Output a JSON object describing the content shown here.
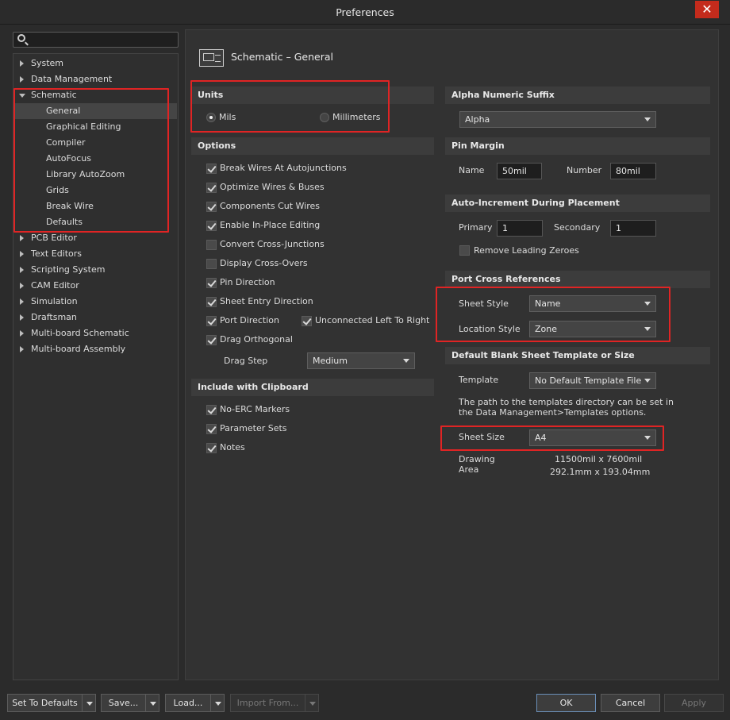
{
  "window": {
    "title": "Preferences",
    "close_glyph": "✕"
  },
  "search": {
    "placeholder": ""
  },
  "tree": [
    {
      "label": "System",
      "state": "collapsed"
    },
    {
      "label": "Data Management",
      "state": "collapsed"
    },
    {
      "label": "Schematic",
      "state": "expanded"
    },
    {
      "label": "General",
      "child": true,
      "selected": true
    },
    {
      "label": "Graphical Editing",
      "child": true
    },
    {
      "label": "Compiler",
      "child": true
    },
    {
      "label": "AutoFocus",
      "child": true
    },
    {
      "label": "Library AutoZoom",
      "child": true
    },
    {
      "label": "Grids",
      "child": true
    },
    {
      "label": "Break Wire",
      "child": true
    },
    {
      "label": "Defaults",
      "child": true
    },
    {
      "label": "PCB Editor",
      "state": "collapsed"
    },
    {
      "label": "Text Editors",
      "state": "collapsed"
    },
    {
      "label": "Scripting System",
      "state": "collapsed"
    },
    {
      "label": "CAM Editor",
      "state": "collapsed"
    },
    {
      "label": "Simulation",
      "state": "collapsed"
    },
    {
      "label": "Draftsman",
      "state": "collapsed"
    },
    {
      "label": "Multi-board Schematic",
      "state": "collapsed"
    },
    {
      "label": "Multi-board Assembly",
      "state": "collapsed"
    }
  ],
  "page": {
    "title": "Schematic – General",
    "icon": "schematic-sheet-icon"
  },
  "units": {
    "header": "Units",
    "mils": "Mils",
    "millimeters": "Millimeters",
    "selected": "Mils"
  },
  "options": {
    "header": "Options",
    "items": [
      {
        "label": "Break Wires At Autojunctions",
        "checked": true
      },
      {
        "label": "Optimize Wires & Buses",
        "checked": true
      },
      {
        "label": "Components Cut Wires",
        "checked": true
      },
      {
        "label": "Enable In-Place Editing",
        "checked": true
      },
      {
        "label": "Convert Cross-Junctions",
        "checked": false
      },
      {
        "label": "Display Cross-Overs",
        "checked": false
      },
      {
        "label": "Pin Direction",
        "checked": true
      },
      {
        "label": "Sheet Entry Direction",
        "checked": true
      },
      {
        "label": "Port Direction",
        "checked": true
      },
      {
        "label": "Drag Orthogonal",
        "checked": true
      }
    ],
    "unconnected": {
      "label": "Unconnected Left To Right",
      "checked": true
    },
    "drag_step_label": "Drag Step",
    "drag_step_value": "Medium"
  },
  "clipboard": {
    "header": "Include with Clipboard",
    "items": [
      {
        "label": "No-ERC Markers",
        "checked": true
      },
      {
        "label": "Parameter Sets",
        "checked": true
      },
      {
        "label": "Notes",
        "checked": true
      }
    ]
  },
  "alpha": {
    "header": "Alpha Numeric Suffix",
    "value": "Alpha"
  },
  "pin_margin": {
    "header": "Pin Margin",
    "name_label": "Name",
    "name_value": "50mil",
    "number_label": "Number",
    "number_value": "80mil"
  },
  "auto_increment": {
    "header": "Auto-Increment During Placement",
    "primary_label": "Primary",
    "primary_value": "1",
    "secondary_label": "Secondary",
    "secondary_value": "1",
    "remove_zeroes_label": "Remove Leading Zeroes",
    "remove_zeroes_checked": false
  },
  "port_cross": {
    "header": "Port Cross References",
    "sheet_style_label": "Sheet Style",
    "sheet_style_value": "Name",
    "location_style_label": "Location Style",
    "location_style_value": "Zone"
  },
  "template": {
    "header": "Default Blank Sheet Template or Size",
    "template_label": "Template",
    "template_value": "No Default Template File",
    "info_line1": "The path to the templates directory can be set in",
    "info_line2": "the Data Management>Templates options.",
    "sheet_size_label": "Sheet Size",
    "sheet_size_value": "A4",
    "drawing_area_label1": "Drawing",
    "drawing_area_label2": "Area",
    "drawing_area_mil": "11500mil x 7600mil",
    "drawing_area_mm": "292.1mm x 193.04mm"
  },
  "buttons": {
    "set_defaults": "Set To Defaults",
    "save": "Save...",
    "load": "Load...",
    "import": "Import From...",
    "ok": "OK",
    "cancel": "Cancel",
    "apply": "Apply"
  },
  "highlight_color": "#e02424"
}
